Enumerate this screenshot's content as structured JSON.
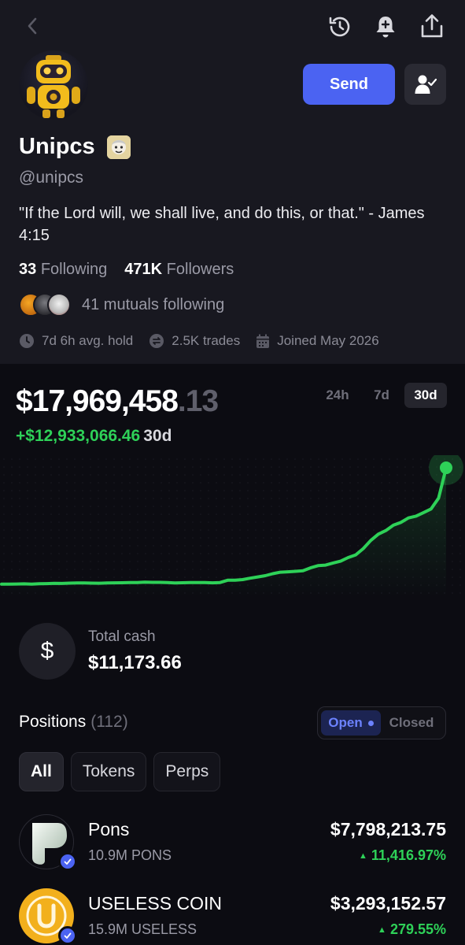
{
  "header": {
    "back_icon": "chevron-left-icon",
    "history_icon": "history-icon",
    "alert_icon": "bell-plus-icon",
    "share_icon": "share-icon"
  },
  "profile": {
    "name": "Unipcs",
    "handle": "@unipcs",
    "bio": "\"If the Lord will, we shall live, and do this, or that.\" - James 4:15",
    "following_count": "33",
    "following_label": "Following",
    "followers_count": "471K",
    "followers_label": "Followers",
    "mutuals_text": "41 mutuals following",
    "avg_hold": "7d 6h avg. hold",
    "trades": "2.5K trades",
    "joined": "Joined May 2026"
  },
  "actions": {
    "send_label": "Send",
    "follow_icon": "user-check-icon"
  },
  "portfolio": {
    "balance_main": "$17,969,458",
    "balance_cents": ".13",
    "pnl_sign": "+",
    "pnl_value": "$12,933,066.46",
    "pnl_period": "30d",
    "ranges": [
      "24h",
      "7d",
      "30d"
    ],
    "active_range": "30d",
    "accent_color": "#2ed158"
  },
  "chart_data": {
    "type": "line",
    "title": "",
    "xlabel": "",
    "ylabel": "",
    "x": [
      0,
      1,
      2,
      3,
      4,
      5,
      6,
      7,
      8,
      9,
      10,
      11,
      12,
      13,
      14,
      15,
      16,
      17,
      18,
      19,
      20,
      21,
      22,
      23,
      24,
      25,
      26,
      27,
      28,
      29,
      30,
      31,
      32,
      33,
      34,
      35,
      36,
      37,
      38,
      39,
      40,
      41,
      42,
      43,
      44,
      45,
      46,
      47,
      48,
      49,
      50,
      51,
      52,
      53,
      54,
      55,
      56,
      57,
      58,
      59
    ],
    "y": [
      5.04,
      5.05,
      5.06,
      5.08,
      5.05,
      5.09,
      5.1,
      5.13,
      5.12,
      5.16,
      5.18,
      5.18,
      5.16,
      5.15,
      5.17,
      5.19,
      5.2,
      5.22,
      5.23,
      5.27,
      5.24,
      5.24,
      5.22,
      5.18,
      5.2,
      5.22,
      5.23,
      5.23,
      5.19,
      5.23,
      5.48,
      5.49,
      5.55,
      5.71,
      5.85,
      5.99,
      6.21,
      6.37,
      6.42,
      6.47,
      6.53,
      6.85,
      7.1,
      7.16,
      7.4,
      7.6,
      8.0,
      8.3,
      9.0,
      9.9,
      10.6,
      11.0,
      11.6,
      11.9,
      12.4,
      12.6,
      13.0,
      13.4,
      14.6,
      17.97
    ],
    "ylim": [
      4.5,
      18.5
    ],
    "grid": false,
    "legend": "none"
  },
  "cash": {
    "icon": "dollar-icon",
    "label": "Total cash",
    "value": "$11,173.66"
  },
  "positions": {
    "title": "Positions",
    "count": "(112)",
    "toggle_open": "Open",
    "toggle_closed": "Closed",
    "filters": [
      "All",
      "Tokens",
      "Perps"
    ],
    "items": [
      {
        "name": "Pons",
        "amount": "10.9M PONS",
        "value": "$7,798,213.75",
        "change": "11,416.97%"
      },
      {
        "name": "USELESS COIN",
        "amount": "15.9M USELESS",
        "value": "$3,293,152.57",
        "change": "279.55%"
      }
    ]
  }
}
